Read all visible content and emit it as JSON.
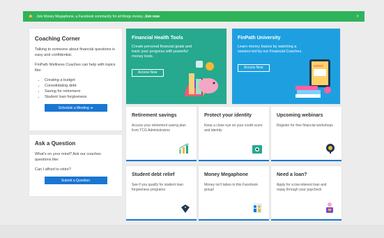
{
  "banner": {
    "icon": "bell-icon",
    "text": "Join Money Megaphone, a Facebook community for all things money.",
    "link": "Join now",
    "close": "×",
    "color": "#2fb35a"
  },
  "coaching": {
    "title": "Coaching Corner",
    "intro": "Talking to someone about financial questions is easy and confidential.",
    "subtext": "FinPath Wellness Coaches can help with topics like:",
    "topics": [
      "Creating a budget",
      "Consolidating debt",
      "Saving for retirement",
      "Student loan forgiveness"
    ],
    "button": "Schedule a Meeting ➜"
  },
  "ask": {
    "title": "Ask a Question",
    "text1": "What's on your mind? Ask our coaches questions like:",
    "text2": "Can I afford to retire?",
    "button": "Submit a Question"
  },
  "tiles": {
    "health": {
      "title": "Financial Health Tools",
      "text": "Create personal financial goals and track your progress with powerful money tools.",
      "button": "Access Now",
      "color": "#26a98f"
    },
    "university": {
      "title": "FinPath University",
      "text": "Learn money basics by watching a session led by our Financial Coaches.",
      "button": "Access Now",
      "color": "#1ea0e0"
    }
  },
  "cards": [
    {
      "title": "Retirement savings",
      "text": "Access your retirement saving plan from TCG Administrators",
      "icon": "chart-icon"
    },
    {
      "title": "Protect your identity",
      "text": "Keep a close eye on your credit score and identity",
      "icon": "id-card-icon"
    },
    {
      "title": "Upcoming webinars",
      "text": "Register for free financial workshops",
      "icon": "webinar-icon"
    },
    {
      "title": "Student debt relief",
      "text": "See if you qualify for student loan forgiveness programs",
      "icon": "graduation-icon"
    },
    {
      "title": "Money Megaphone",
      "text": "Money isn't taboo in this Facebook group!",
      "icon": "community-icon"
    },
    {
      "title": "Need a loan?",
      "text": "Apply for a low-interest loan and repay through your paycheck",
      "icon": "loan-icon"
    }
  ],
  "accent": "#1976d2"
}
